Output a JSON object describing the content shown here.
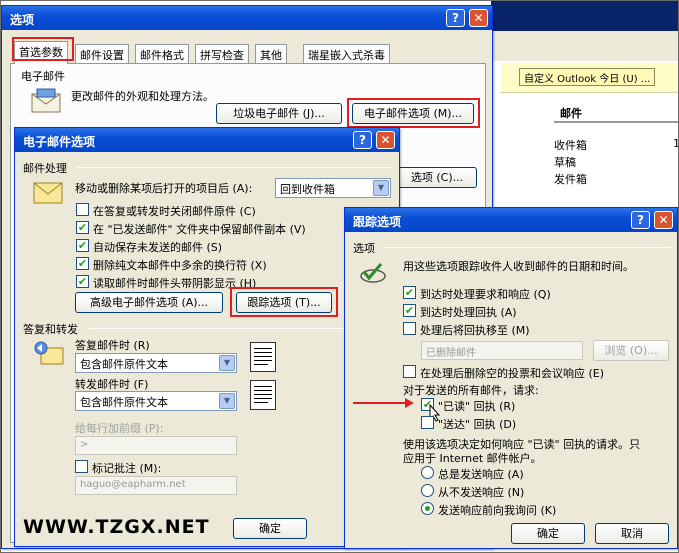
{
  "background": {
    "customize_button": "自定义 Outlook 今日 (U) ...",
    "mail_header": "邮件",
    "rows": [
      "收件箱",
      "草稿",
      "发件箱"
    ],
    "inbox_count": "1"
  },
  "options_dialog": {
    "title": "选项",
    "help": "?",
    "close": "✕",
    "tabs": [
      "首选参数",
      "邮件设置",
      "邮件格式",
      "拼写检查",
      "其他",
      "瑞星嵌入式杀毒"
    ],
    "email_section": "电子邮件",
    "email_desc": "更改邮件的外观和处理方法。",
    "junk_button": "垃圾电子邮件 (J)...",
    "email_options_button": "电子邮件选项 (M)...",
    "partial_button": "选项 (C)..."
  },
  "email_options": {
    "title": "电子邮件选项",
    "help": "?",
    "close": "✕",
    "message_handling": "邮件处理",
    "after_move_label": "移动或删除某项后打开的项目后 (A):",
    "after_move_value": "回到收件箱",
    "checks": [
      {
        "label": "在答复或转发时关闭邮件原件 (C)",
        "checked": false
      },
      {
        "label": "在 \"已发送邮件\" 文件夹中保留邮件副本 (V)",
        "checked": true
      },
      {
        "label": "自动保存未发送的邮件 (S)",
        "checked": true
      },
      {
        "label": "删除纯文本邮件中多余的换行符 (X)",
        "checked": true
      },
      {
        "label": "读取邮件时邮件头带阴影显示 (H)",
        "checked": true
      }
    ],
    "advanced_button": "高级电子邮件选项 (A)...",
    "tracking_button": "跟踪选项 (T)...",
    "reply_forward": "答复和转发",
    "reply_label": "答复邮件时 (R)",
    "reply_value": "包含邮件原件文本",
    "forward_label": "转发邮件时 (F)",
    "forward_value": "包含邮件原件文本",
    "prefix_label": "给每行加前缀 (P):",
    "prefix_value": ">",
    "mark_label": "标记批注 (M):",
    "mark_value": "haguo@eapharm.net",
    "ok": "确定"
  },
  "tracking": {
    "title": "跟踪选项",
    "help": "?",
    "close": "✕",
    "section": "选项",
    "desc": "用这些选项跟踪收件人收到邮件的日期和时间。",
    "checks": [
      {
        "label": "到达时处理要求和响应 (Q)",
        "checked": true
      },
      {
        "label": "到达时处理回执 (A)",
        "checked": true
      },
      {
        "label": "处理后将回执移至 (M)",
        "checked": false
      }
    ],
    "deleted_folder": "已删除邮件",
    "browse": "浏览 (O)...",
    "delete_blank": "在处理后删除空的投票和会议响应 (E)",
    "all_sent": "对于发送的所有邮件，请求:",
    "read_receipt": "\"已读\" 回执 (R)",
    "read_checked": true,
    "delivery_receipt": "\"送达\" 回执 (D)",
    "delivery_checked": false,
    "respond_desc_1": "使用该选项决定如何响应 \"已读\" 回执的请求。只",
    "respond_desc_2": "应用于 Internet 邮件帐户。",
    "radios": [
      {
        "label": "总是发送响应 (A)",
        "selected": false
      },
      {
        "label": "从不发送响应 (N)",
        "selected": false
      },
      {
        "label": "发送响应前向我询问 (K)",
        "selected": true
      }
    ],
    "ok": "确定",
    "cancel": "取消"
  },
  "watermark": "WWW.TZGX.NET",
  "colors": {
    "highlight": "#e02020",
    "titlebar": "#0a4ed6",
    "dialog_bg": "#ece9d8"
  }
}
